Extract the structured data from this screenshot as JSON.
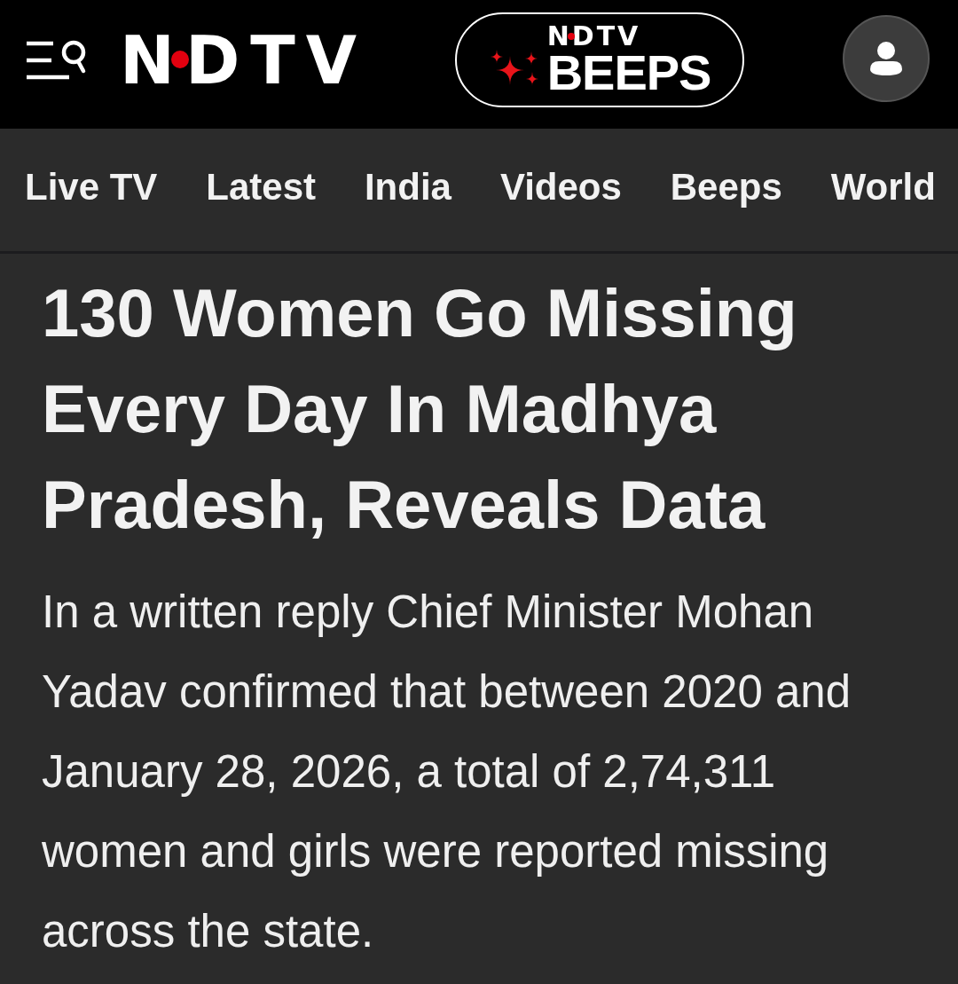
{
  "header": {
    "logo": "NDTV",
    "beeps": {
      "brand": "NDTV",
      "label": "BEEPS"
    }
  },
  "nav": [
    {
      "label": "Live TV"
    },
    {
      "label": "Latest"
    },
    {
      "label": "India"
    },
    {
      "label": "Videos"
    },
    {
      "label": "Beeps"
    },
    {
      "label": "World"
    }
  ],
  "article": {
    "headline": "130 Women Go Missing Every Day In Madhya Pradesh, Reveals Data",
    "summary": "In a written reply Chief Minister Mohan Yadav confirmed that between 2020 and January 28, 2026, a total of 2,74,311 women and girls were reported missing across the state."
  }
}
